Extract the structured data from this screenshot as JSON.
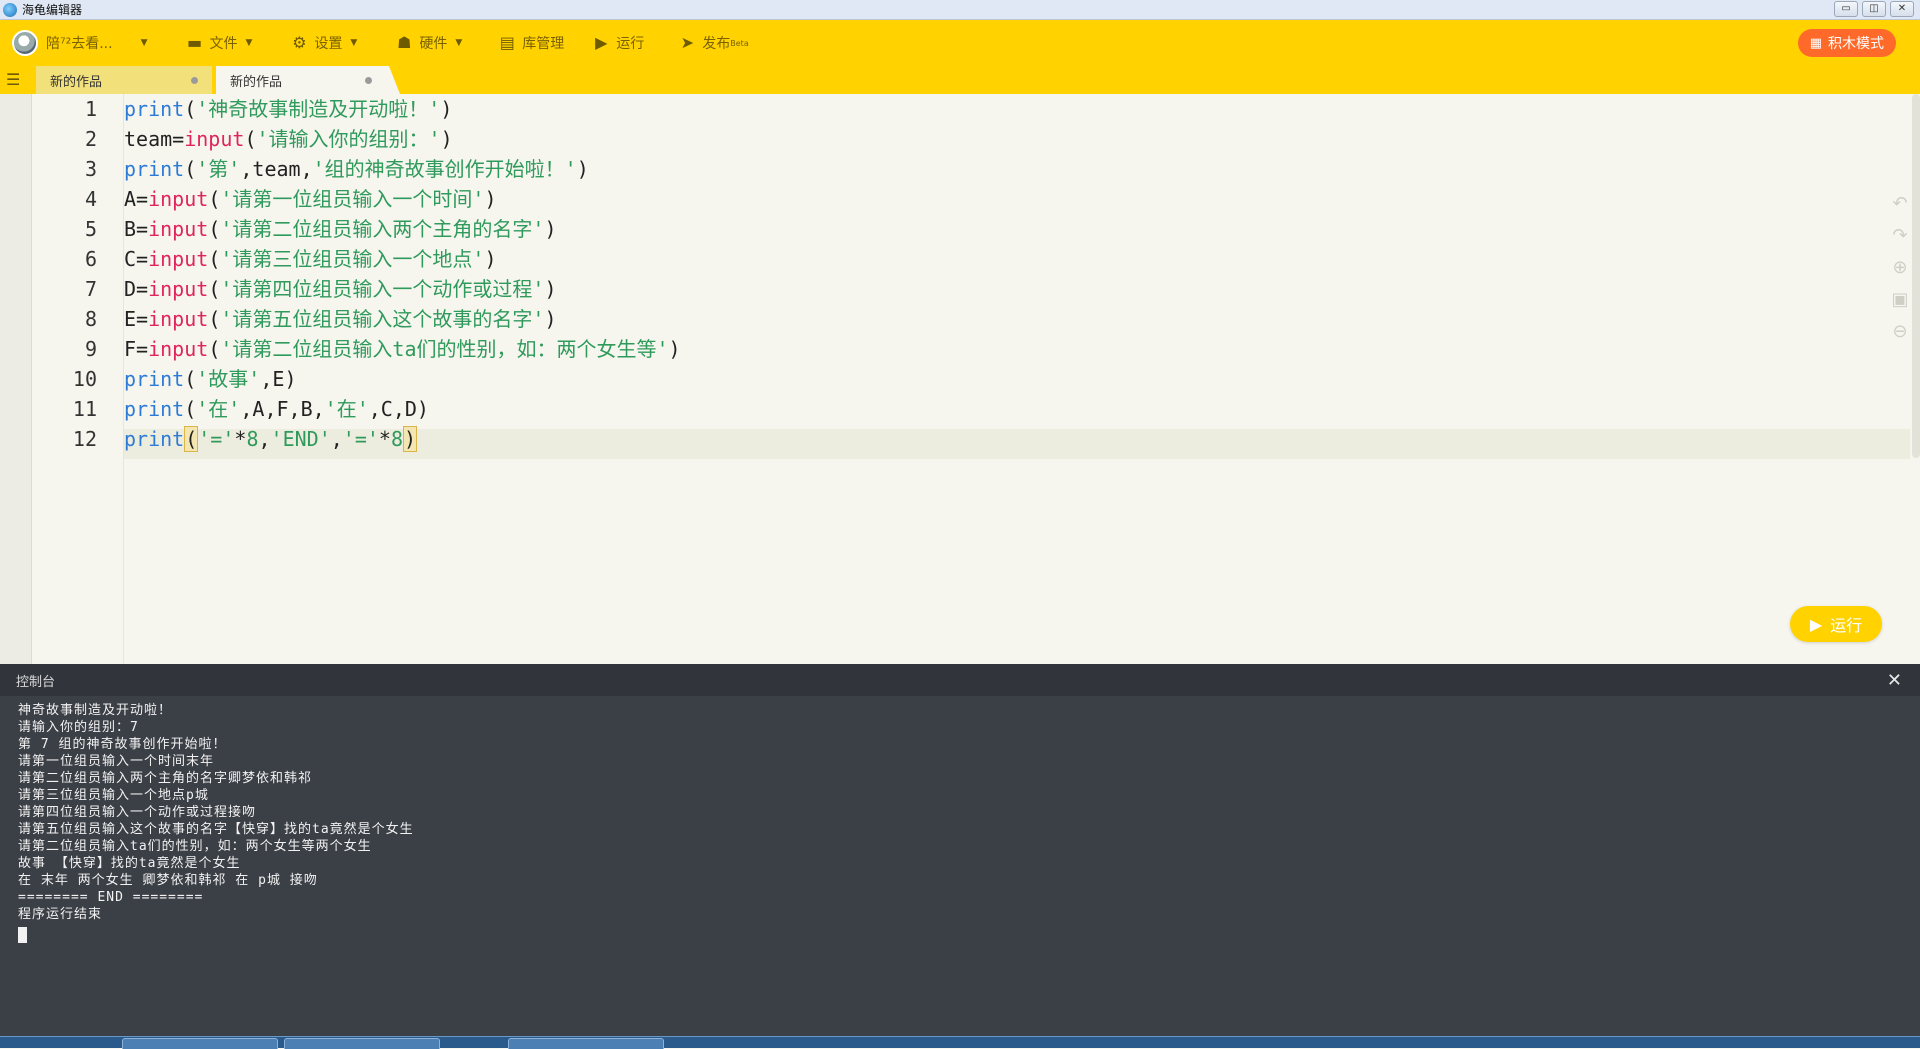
{
  "window": {
    "title": "海龟编辑器",
    "minimize_icon": "minimize-icon",
    "maximize_icon": "maximize-icon",
    "close_icon": "close-icon"
  },
  "toolbar": {
    "user": "陪⁷²去看...",
    "menus": [
      {
        "label": "文件",
        "icon": "folder-icon"
      },
      {
        "label": "设置",
        "icon": "gear-icon"
      },
      {
        "label": "硬件",
        "icon": "robot-icon"
      }
    ],
    "library": "库管理",
    "run": "运行",
    "publish": "发布",
    "publish_badge": "Beta",
    "blocks_mode": "积木模式"
  },
  "tabs": [
    {
      "label": "新的作品",
      "active": false
    },
    {
      "label": "新的作品",
      "active": true
    }
  ],
  "editor": {
    "line_numbers": [
      "1",
      "2",
      "3",
      "4",
      "5",
      "6",
      "7",
      "8",
      "9",
      "10",
      "11",
      "12"
    ],
    "current_line": 12
  },
  "run_button": "运行",
  "console": {
    "title": "控制台",
    "lines": [
      "神奇故事制造及开动啦！",
      "请输入你的组别：7",
      "第 7 组的神奇故事创作开始啦！",
      "请第一位组员输入一个时间末年",
      "请第二位组员输入两个主角的名字卿梦依和韩祁",
      "请第三位组员输入一个地点p城",
      "请第四位组员输入一个动作或过程接吻",
      "请第五位组员输入这个故事的名字【快穿】找的ta竟然是个女生",
      "请第二位组员输入ta们的性别，如：两个女生等两个女生",
      "故事 【快穿】找的ta竟然是个女生",
      "在 末年 两个女生 卿梦依和韩祁 在 p城 接吻",
      "======== END ========",
      "程序运行结束"
    ]
  }
}
